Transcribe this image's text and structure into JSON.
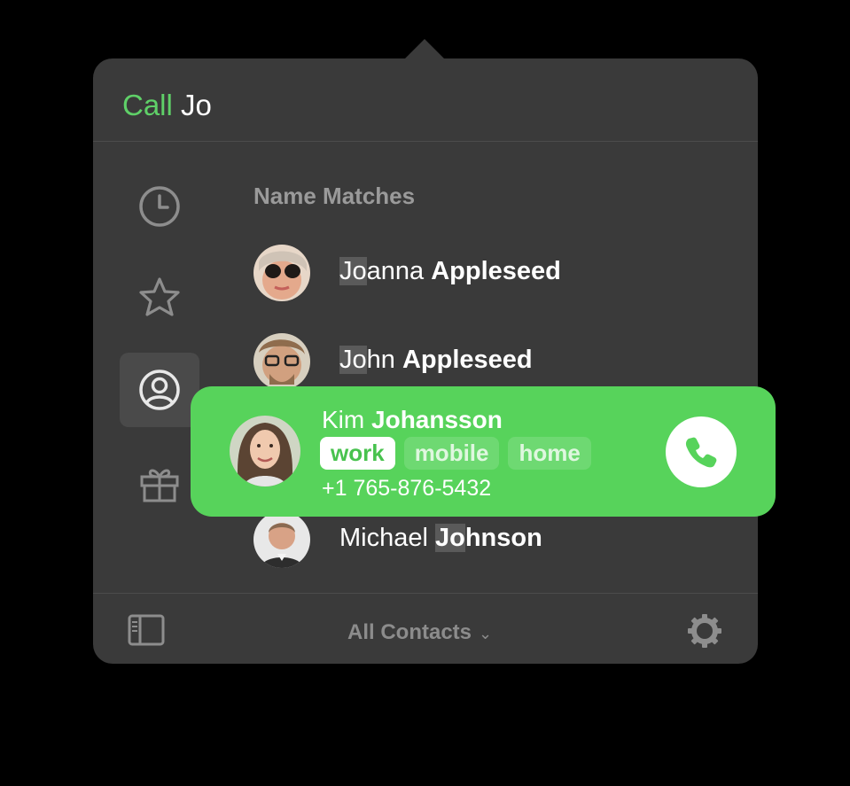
{
  "search": {
    "verb": "Call",
    "query": "Jo"
  },
  "sidebar": {
    "items": [
      {
        "icon": "clock-icon"
      },
      {
        "icon": "star-icon"
      },
      {
        "icon": "person-circle-icon",
        "active": true
      },
      {
        "icon": "gift-icon"
      }
    ]
  },
  "results": {
    "section_title": "Name Matches",
    "contacts": [
      {
        "match": "Jo",
        "rest_first": "anna",
        "last": "Appleseed"
      },
      {
        "match": "Jo",
        "rest_first": "hn",
        "last": "Appleseed"
      },
      {
        "first": "Michael",
        "last_match": "Jo",
        "last_rest": "hnson"
      }
    ]
  },
  "selected_contact": {
    "first": "Kim",
    "last": "Johansson",
    "phone_labels": [
      "work",
      "mobile",
      "home"
    ],
    "selected_label": "work",
    "phone": "+1 765-876-5432"
  },
  "footer": {
    "group_label": "All Contacts",
    "group_chevron": "⌄"
  },
  "colors": {
    "accent": "#57d35b",
    "panel": "#3a3a3a",
    "text_muted": "#9a9a9a"
  }
}
